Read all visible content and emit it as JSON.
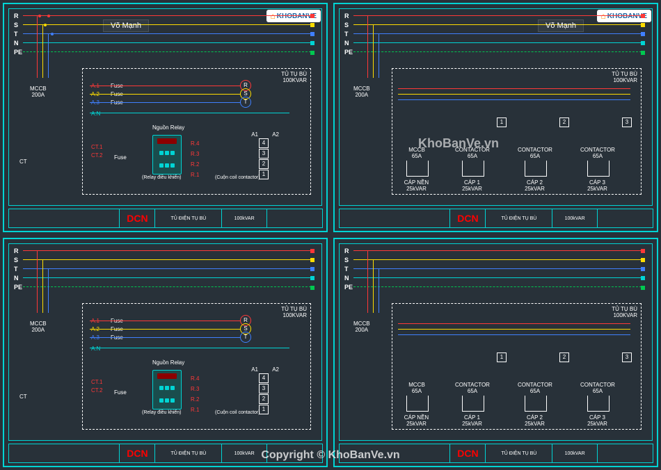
{
  "bus": {
    "labels": [
      "R",
      "S",
      "T",
      "N",
      "PE"
    ]
  },
  "author": "Võ Mạnh",
  "site_logo": "KHOBANVE",
  "watermark": "KhoBanVe.vn",
  "copyright": "Copyright © KhoBanVe.vn",
  "cabinet": {
    "title": "TỦ TỤ BÙ",
    "rating": "100KVAR"
  },
  "mccb_main": {
    "name": "MCCB",
    "rating": "200A"
  },
  "left_panel": {
    "fuse": "Fuse",
    "fuse_tags": [
      "A.1",
      "A.2",
      "A.3",
      "A.N"
    ],
    "phases": [
      "R",
      "S",
      "T"
    ],
    "relay_source": "Nguồn Relay",
    "relay_caption": "(Relay điều khiển)",
    "coil_caption": "(Cuộn coil contactor)",
    "ct": "CT",
    "ct_tags": [
      "CT.1",
      "CT.2"
    ],
    "r_tags": [
      "R.1",
      "R.2",
      "R.3",
      "R.4"
    ],
    "a_tags": [
      "A1",
      "A2"
    ],
    "step_nums": [
      "4",
      "3",
      "2",
      "1"
    ]
  },
  "right_panel": {
    "mccb_branch": {
      "name": "MCCB",
      "rating": "65A"
    },
    "contactor": {
      "name": "CONTACTOR",
      "rating": "65A"
    },
    "caps": [
      {
        "name": "CÁP NỀN",
        "rating": "25kVAR"
      },
      {
        "name": "CÁP 1",
        "rating": "25kVAR"
      },
      {
        "name": "CÁP 2",
        "rating": "25kVAR"
      },
      {
        "name": "CÁP 3",
        "rating": "25kVAR"
      }
    ],
    "step_boxes": [
      "1",
      "2",
      "3"
    ]
  },
  "title_block": {
    "logo": "DCN",
    "title": "TỦ ĐIỆN TỤ BÙ",
    "sub": "100kVAR"
  }
}
